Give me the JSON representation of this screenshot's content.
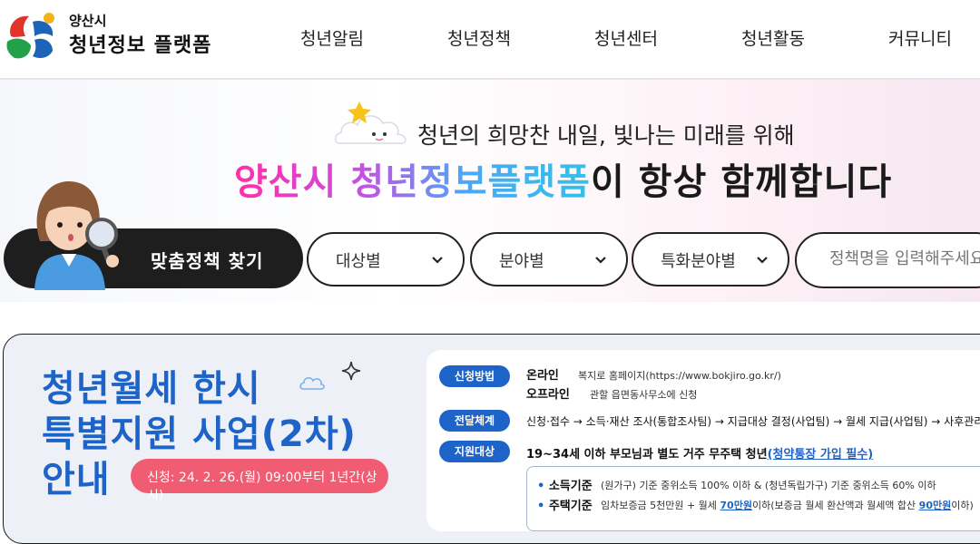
{
  "header": {
    "logo_small": "양산시",
    "logo_big": "청년정보 플랫폼",
    "nav": [
      "청년알림",
      "청년정책",
      "청년센터",
      "청년활동",
      "커뮤니티"
    ]
  },
  "hero": {
    "tagline": "청년의 희망찬 내일, 빛나는 미래를 위해",
    "headline_color": "양산시 청년정보플랫폼",
    "headline_rest": "이 항상 함께합니다"
  },
  "search": {
    "match_button": "맞춤정책 찾기",
    "filters": [
      "대상별",
      "분야별",
      "특화분야별"
    ],
    "placeholder": "정책명을 입력해주세요"
  },
  "banner": {
    "title_lines": [
      "청년월세 한시",
      "특별지원 사업(2차)",
      "안내"
    ],
    "date": "신청: 24. 2. 26.(월) 09:00부터 1년간(상시)",
    "apply_tag": "신청방법",
    "online_label": "온라인",
    "online_desc": "복지로 홈페이지(https://www.bokjiro.go.kr/)",
    "offline_label": "오프라인",
    "offline_desc": "관할 읍면동사무소에 신청",
    "flow_tag": "전달체계",
    "flow_text": "신청·접수 → 소득·재산 조사(통합조사팀) → 지급대상 결정(사업팀) → 월세 지급(사업팀) → 사후관리",
    "target_tag": "지원대상",
    "target_text": "19~34세 이하 부모님과 별도 거주 무주택 청년",
    "target_note": "(청약통장 가입 필수)",
    "income_label": "소득기준",
    "income_text": "(원가구) 기준 중위소득 100% 이하 & (청년독립가구) 기준 중위소득 60% 이하",
    "house_label": "주택기준",
    "house_text_1": "임차보증금 5천만원 + 월세",
    "house_amount_1": "70만원",
    "house_text_2": "이하(보증금 월세 환산액과 월세액 합산",
    "house_amount_2": "90만원",
    "house_text_3": "이하)"
  },
  "colors": {
    "primary_blue": "#1e63c8",
    "date_pill": "#f05d73",
    "dark_button": "#1e1e1e"
  }
}
